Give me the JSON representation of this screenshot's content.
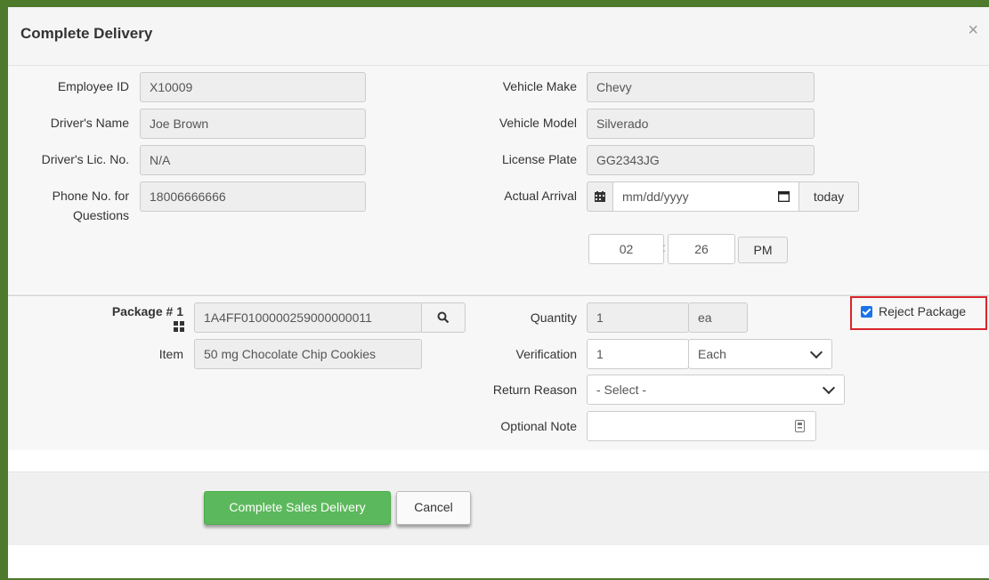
{
  "header": {
    "title": "Complete Delivery",
    "close": "×"
  },
  "driver": {
    "employee_id_label": "Employee ID",
    "employee_id": "X10009",
    "name_label": "Driver's Name",
    "name": "Joe Brown",
    "lic_label": "Driver's Lic. No.",
    "lic": "N/A",
    "phone_label_line1": "Phone No. for",
    "phone_label_line2": "Questions",
    "phone": "18006666666"
  },
  "vehicle": {
    "make_label": "Vehicle Make",
    "make": "Chevy",
    "model_label": "Vehicle Model",
    "model": "Silverado",
    "plate_label": "License Plate",
    "plate": "GG2343JG"
  },
  "arrival": {
    "label": "Actual Arrival",
    "date_placeholder": "mm/dd/yyyy",
    "today_label": "today",
    "hour": "02",
    "separator": ":",
    "minute": "26",
    "ampm": "PM"
  },
  "package": {
    "label": "Package # 1",
    "id": "1A4FF0100000259000000011",
    "item_label": "Item",
    "item": "50 mg Chocolate Chip Cookies",
    "quantity_label": "Quantity",
    "quantity": "1",
    "quantity_unit": "ea",
    "verification_label": "Verification",
    "verification": "1",
    "verification_unit": "Each",
    "return_reason_label": "Return Reason",
    "return_reason": "- Select -",
    "note_label": "Optional Note",
    "note": "",
    "reject_label": "Reject Package",
    "reject_checked": true
  },
  "footer": {
    "complete_label": "Complete Sales Delivery",
    "cancel_label": "Cancel"
  },
  "colors": {
    "frame": "#4e7a2c",
    "primary": "#5cb85c",
    "highlight": "#d9242c",
    "checkbox": "#1a73e8"
  }
}
